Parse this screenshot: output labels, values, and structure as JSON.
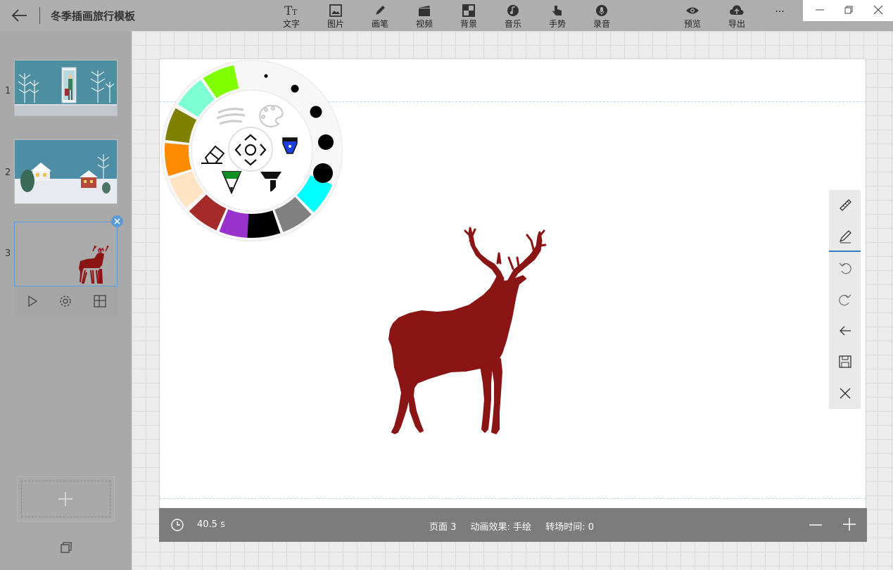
{
  "header": {
    "title": "冬季插画旅行模板",
    "tools": [
      {
        "label": "文字",
        "icon": "text-icon"
      },
      {
        "label": "图片",
        "icon": "image-icon"
      },
      {
        "label": "画笔",
        "icon": "pen-icon"
      },
      {
        "label": "视频",
        "icon": "video-icon"
      },
      {
        "label": "背景",
        "icon": "background-icon"
      },
      {
        "label": "音乐",
        "icon": "music-icon"
      },
      {
        "label": "手势",
        "icon": "gesture-icon"
      },
      {
        "label": "录音",
        "icon": "microphone-icon"
      }
    ],
    "right_tools": [
      {
        "label": "预览",
        "icon": "eye-icon"
      },
      {
        "label": "导出",
        "icon": "cloud-upload-icon"
      }
    ],
    "more": "···"
  },
  "slides": [
    {
      "number": "1"
    },
    {
      "number": "2"
    },
    {
      "number": "3",
      "selected": true
    }
  ],
  "status": {
    "duration": "40.5 s",
    "page": "页面 3",
    "animation": "动画效果: 手绘",
    "transition": "转场时间: 0"
  },
  "palette": {
    "colors": [
      "#7fff00",
      "#7fffd4",
      "#808000",
      "#ff8c00",
      "#ffe4c4",
      "#a52a2a",
      "#9932cc",
      "#000000",
      "#808080",
      "#00ffff"
    ],
    "pens": [
      "eraser-icon",
      "move-icon",
      "blue-pen-icon",
      "green-pencil-icon",
      "black-marker-icon"
    ]
  },
  "canvas": {
    "figure_color": "#8b1414"
  }
}
